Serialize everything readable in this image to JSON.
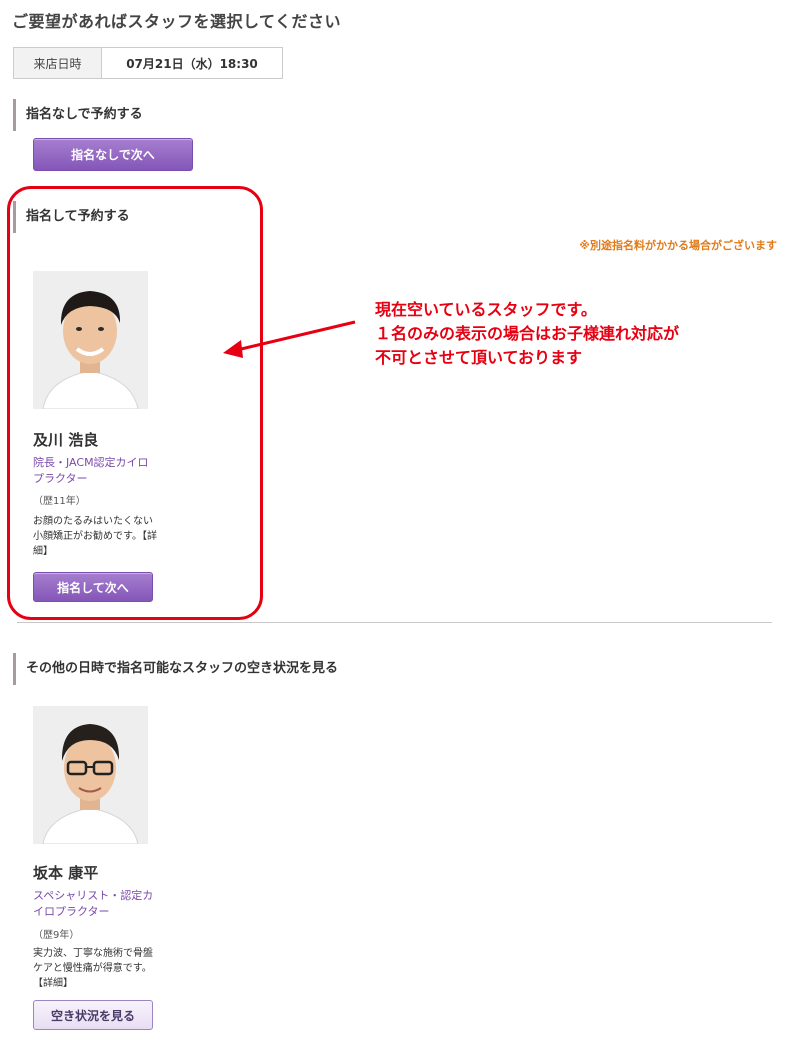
{
  "page": {
    "title": "ご要望があればスタッフを選択してください",
    "visit": {
      "label": "来店日時",
      "value": "07月21日（水）18:30"
    }
  },
  "no_nomination": {
    "heading": "指名なしで予約する",
    "button": "指名なしで次へ"
  },
  "nomination": {
    "heading": "指名して予約する",
    "note": "※別途指名料がかかる場合がございます",
    "staff": {
      "name": "及川 浩良",
      "role": "院長・JACM認定カイロプラクター",
      "experience": "（歴11年）",
      "desc": "お顔のたるみはいたくない小顔矯正がお勧めです。",
      "detail_link": "【詳細】",
      "button": "指名して次へ"
    }
  },
  "annotation": {
    "line1": "現在空いているスタッフです。",
    "line2": "１名のみの表示の場合はお子様連れ対応が",
    "line3": "不可とさせて頂いております",
    "color": "#e60012"
  },
  "other": {
    "heading": "その他の日時で指名可能なスタッフの空き状況を見る",
    "staff": {
      "name": "坂本 康平",
      "role": "スペシャリスト・認定カイロプラクター",
      "experience": "（歴9年）",
      "desc": "実力波、丁寧な施術で骨盤ケアと慢性痛が得意です。",
      "detail_link": "【詳細】",
      "button": "空き状況を見る"
    }
  },
  "colors": {
    "accent": "#8456b8",
    "note": "#e07b1a",
    "highlight": "#e60012"
  }
}
